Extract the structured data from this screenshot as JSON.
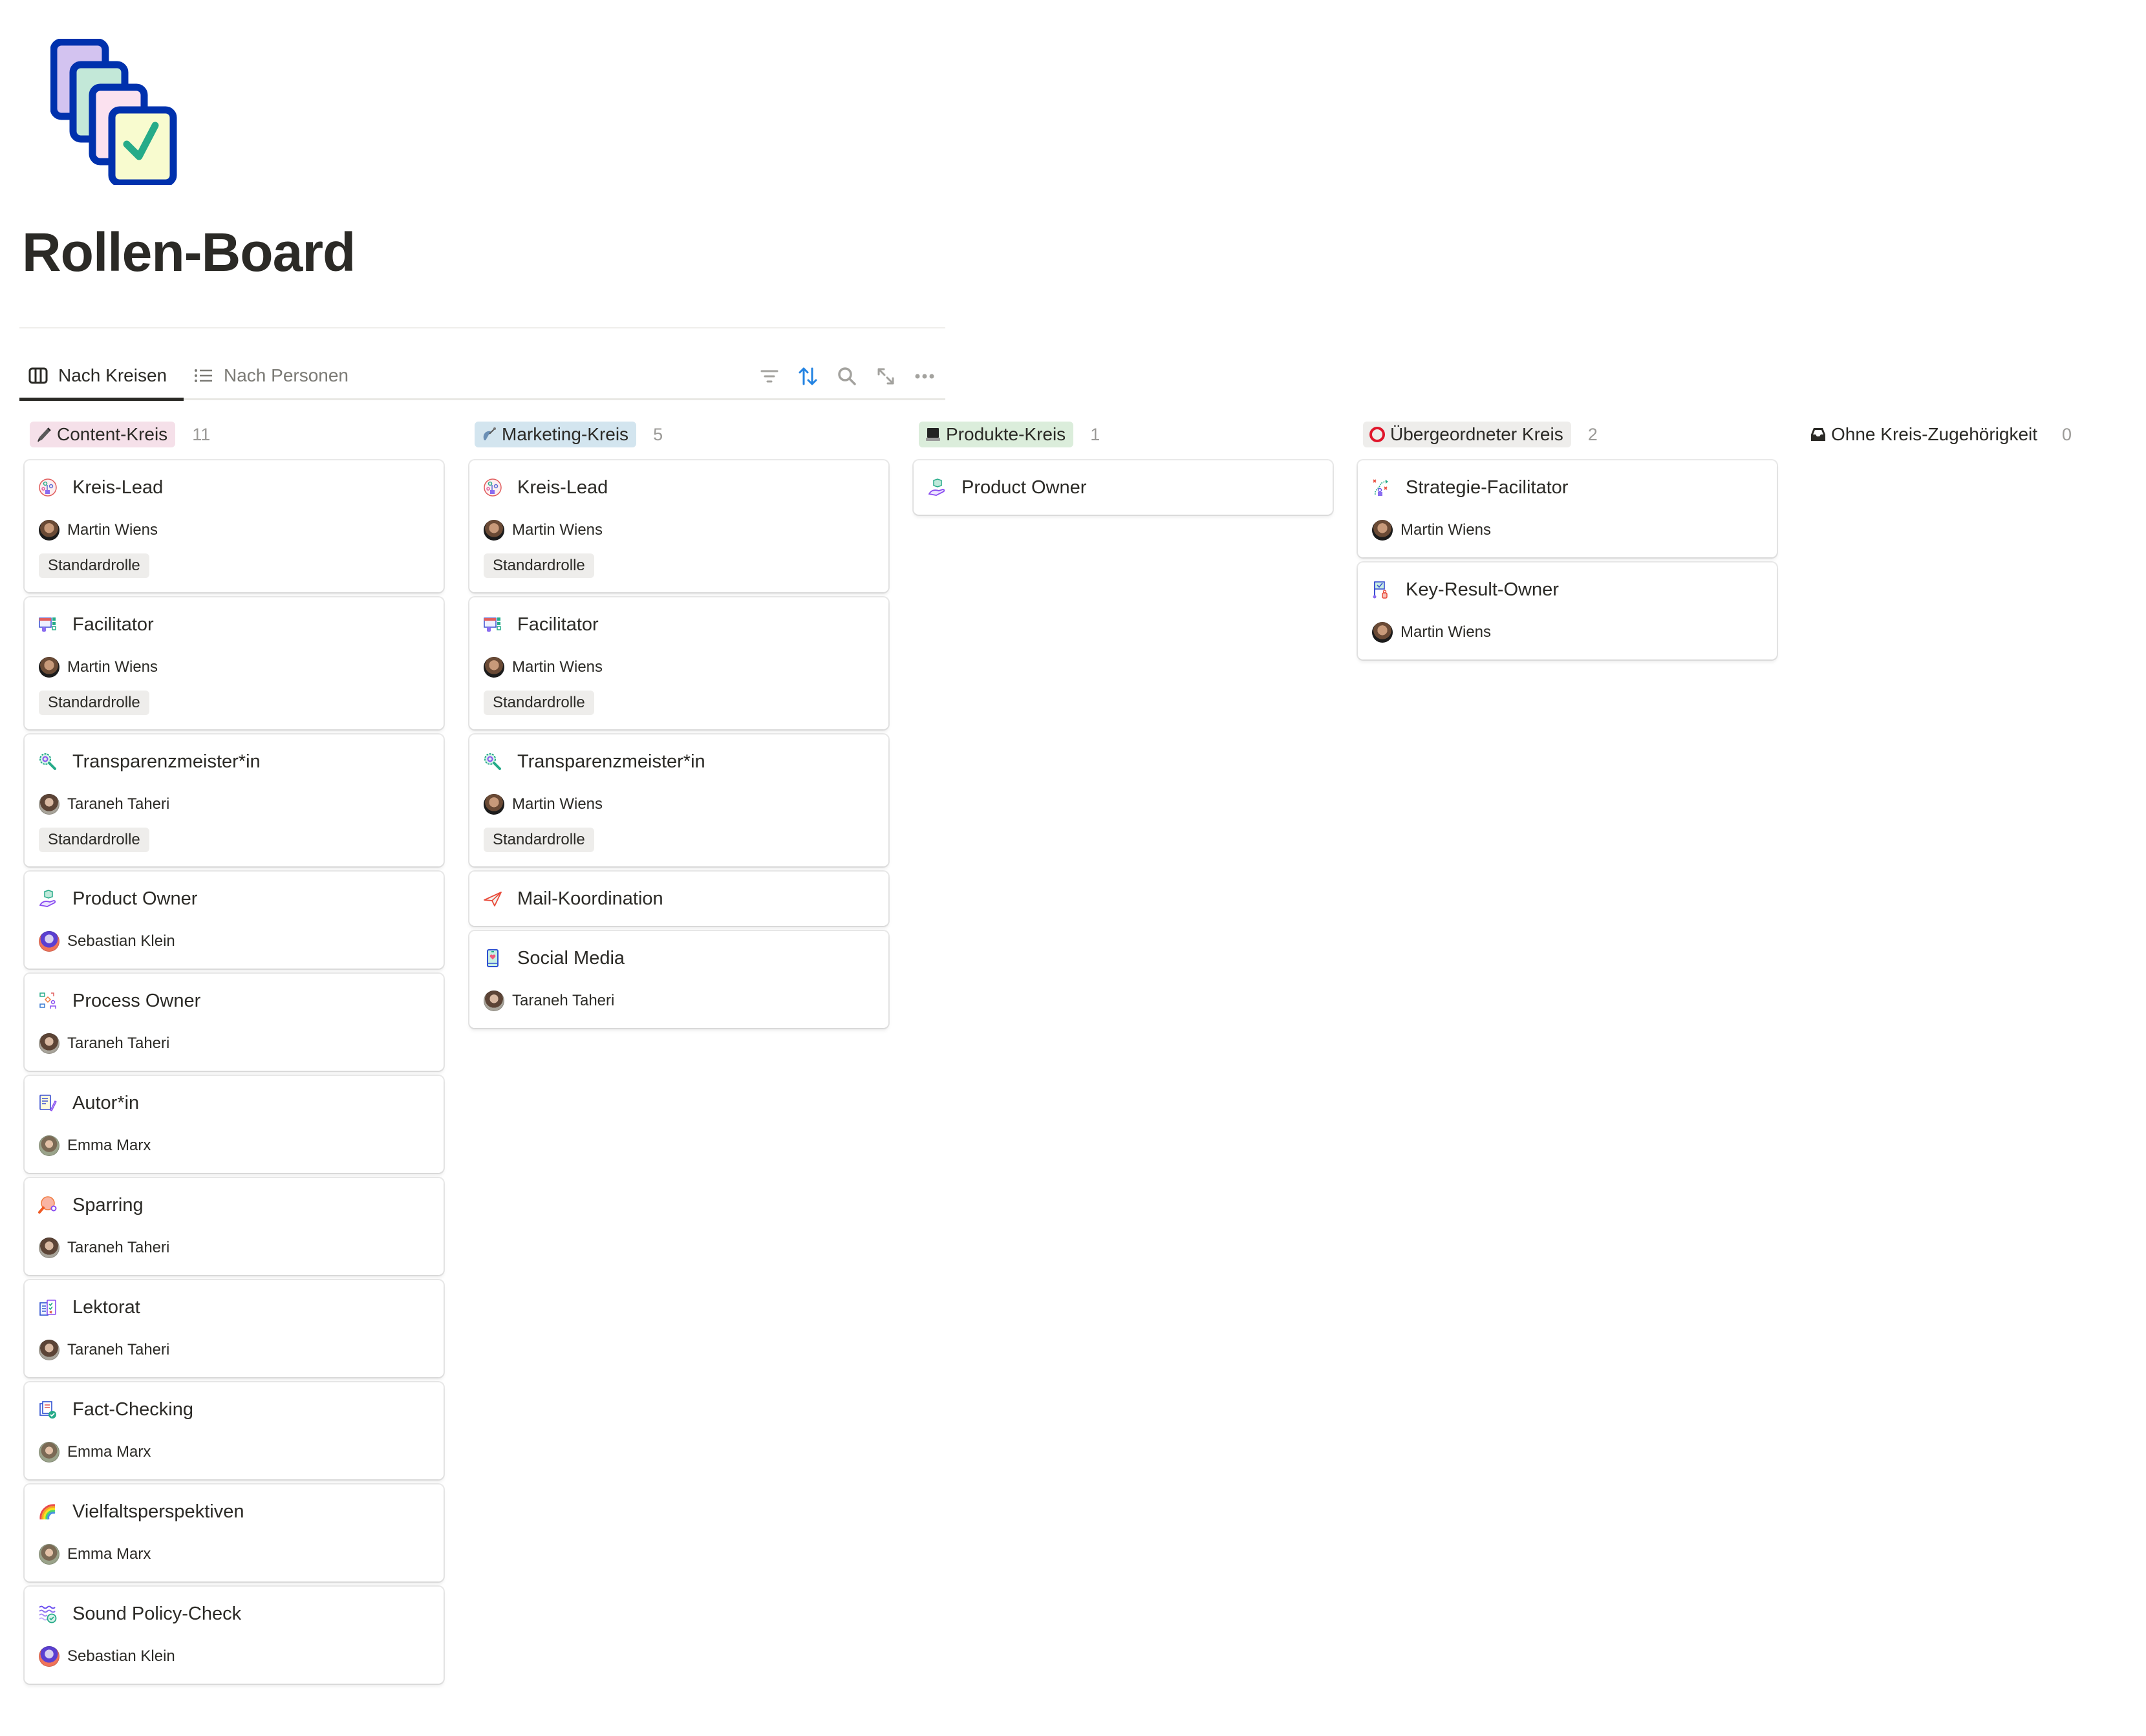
{
  "page": {
    "title": "Rollen-Board",
    "icon": "stacked-cards-checkmark-icon"
  },
  "views": {
    "tabs": [
      {
        "label": "Nach Kreisen",
        "icon": "board-columns-icon",
        "active": true
      },
      {
        "label": "Nach Personen",
        "icon": "list-icon",
        "active": false
      }
    ],
    "toolbar": [
      {
        "name": "filter",
        "icon": "filter-icon"
      },
      {
        "name": "sort",
        "icon": "sort-arrows-icon",
        "active_color": "#2383e2"
      },
      {
        "name": "search",
        "icon": "search-icon"
      },
      {
        "name": "expand",
        "icon": "expand-arrows-icon"
      },
      {
        "name": "more",
        "icon": "more-dots-icon"
      }
    ]
  },
  "colors": {
    "content_kreis": "#f5e0e9",
    "marketing_kreis": "#d3e5ef",
    "produkte_kreis": "#dbeddb",
    "uebergeordneter_kreis": "#eeedeb",
    "tag_bg": "#eeedeb",
    "accent": "#2383e2"
  },
  "board": {
    "columns": [
      {
        "name": "Content-Kreis",
        "icon": "fountain-pen-icon",
        "count": "11",
        "color": "#f5e0e9",
        "cards": [
          {
            "title": "Kreis-Lead",
            "icon": "org-chart-icon",
            "person": "Martin Wiens",
            "tag": "Standardrolle"
          },
          {
            "title": "Facilitator",
            "icon": "calendar-checklist-icon",
            "person": "Martin Wiens",
            "tag": "Standardrolle"
          },
          {
            "title": "Transparenzmeister*in",
            "icon": "magnifier-eye-icon",
            "person": "Taraneh Taheri",
            "tag": "Standardrolle"
          },
          {
            "title": "Product Owner",
            "icon": "hand-box-icon",
            "person": "Sebastian Klein"
          },
          {
            "title": "Process Owner",
            "icon": "process-flow-icon",
            "person": "Taraneh Taheri"
          },
          {
            "title": "Autor*in",
            "icon": "document-pen-icon",
            "person": "Emma Marx"
          },
          {
            "title": "Sparring",
            "icon": "ping-pong-icon",
            "person": "Taraneh Taheri"
          },
          {
            "title": "Lektorat",
            "icon": "clipboard-check-icon",
            "person": "Taraneh Taheri"
          },
          {
            "title": "Fact-Checking",
            "icon": "document-verified-icon",
            "person": "Emma Marx"
          },
          {
            "title": "Vielfaltsperspektiven",
            "icon": "rainbow-icon",
            "person": "Emma Marx"
          },
          {
            "title": "Sound Policy-Check",
            "icon": "sound-waves-check-icon",
            "person": "Sebastian Klein"
          }
        ]
      },
      {
        "name": "Marketing-Kreis",
        "icon": "satellite-dish-icon",
        "count": "5",
        "color": "#d3e5ef",
        "cards": [
          {
            "title": "Kreis-Lead",
            "icon": "org-chart-icon",
            "person": "Martin Wiens",
            "tag": "Standardrolle"
          },
          {
            "title": "Facilitator",
            "icon": "calendar-checklist-icon",
            "person": "Martin Wiens",
            "tag": "Standardrolle"
          },
          {
            "title": "Transparenzmeister*in",
            "icon": "magnifier-eye-icon",
            "person": "Martin Wiens",
            "tag": "Standardrolle"
          },
          {
            "title": "Mail-Koordination",
            "icon": "paper-plane-icon"
          },
          {
            "title": "Social Media",
            "icon": "smartphone-heart-icon",
            "person": "Taraneh Taheri"
          }
        ]
      },
      {
        "name": "Produkte-Kreis",
        "icon": "laptop-icon",
        "count": "1",
        "color": "#dbeddb",
        "cards": [
          {
            "title": "Product Owner",
            "icon": "hand-box-icon"
          }
        ]
      },
      {
        "name": "Übergeordneter Kreis",
        "icon": "red-circle-icon",
        "count": "2",
        "color": "#eeedeb",
        "cards": [
          {
            "title": "Strategie-Facilitator",
            "icon": "strategy-plan-icon",
            "person": "Martin Wiens"
          },
          {
            "title": "Key-Result-Owner",
            "icon": "key-result-flag-icon",
            "person": "Martin Wiens"
          }
        ]
      },
      {
        "name": "Ohne Kreis-Zugehörigkeit",
        "icon": "inbox-tray-icon",
        "count": "0",
        "color": "",
        "cards": []
      }
    ]
  }
}
